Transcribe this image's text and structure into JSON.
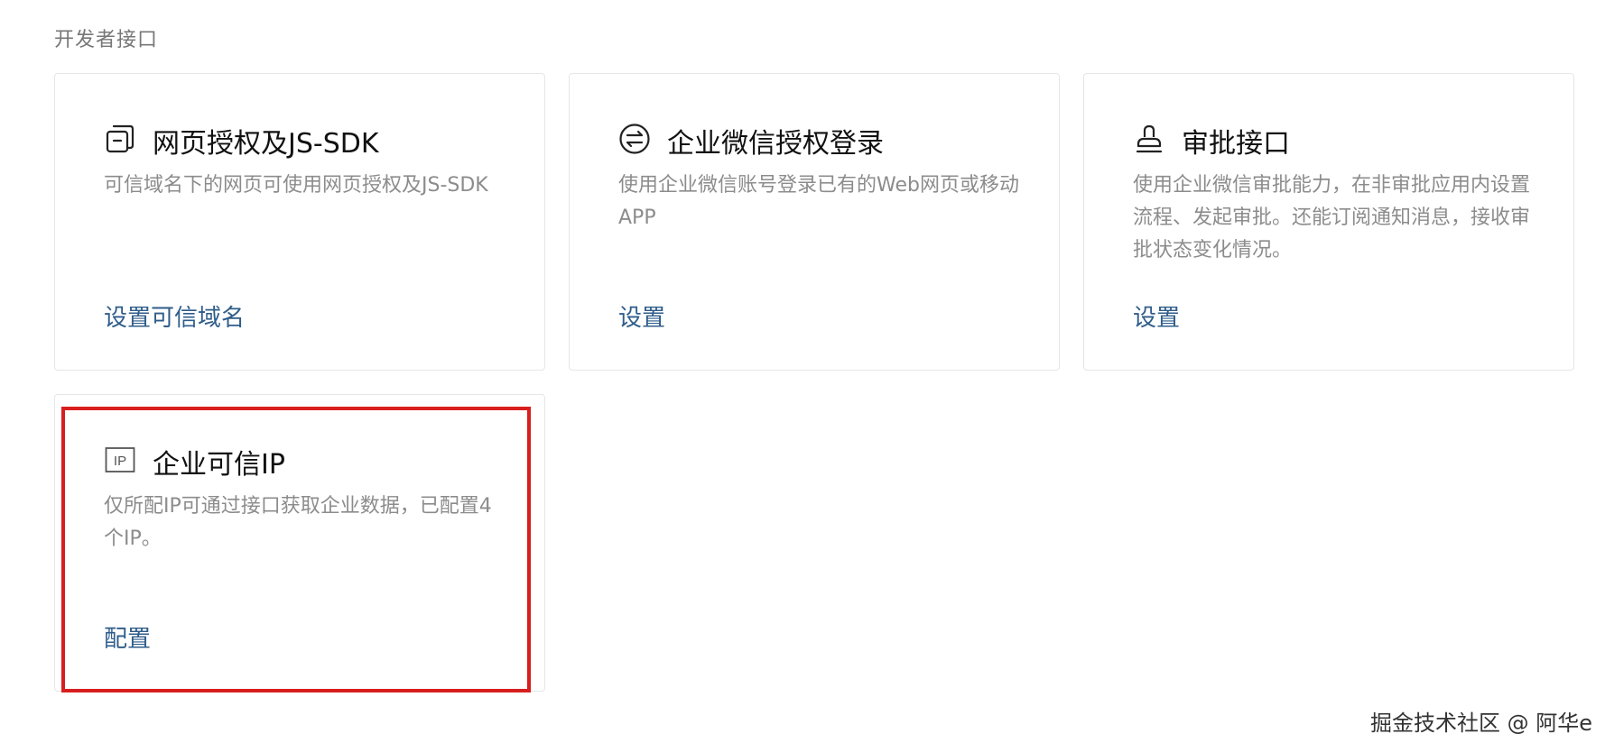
{
  "section": {
    "title": "开发者接口"
  },
  "cards": [
    {
      "icon": "webpage-copy-icon",
      "title": "网页授权及JS-SDK",
      "desc": "可信域名下的网页可使用网页授权及JS-SDK",
      "link": "设置可信域名"
    },
    {
      "icon": "exchange-circle-icon",
      "title": "企业微信授权登录",
      "desc": "使用企业微信账号登录已有的Web网页或移动APP",
      "link": "设置"
    },
    {
      "icon": "stamp-icon",
      "title": "审批接口",
      "desc": "使用企业微信审批能力，在非审批应用内设置流程、发起审批。还能订阅通知消息，接收审批状态变化情况。",
      "link": "设置"
    },
    {
      "icon": "ip-box-icon",
      "icon_text": "IP",
      "title": "企业可信IP",
      "desc": "仅所配IP可通过接口获取企业数据，已配置4个IP。",
      "link": "配置"
    }
  ],
  "watermark": "掘金技术社区 @ 阿华e",
  "colors": {
    "link": "#2f5d8a",
    "highlight": "#d81e1e",
    "border": "#e4e6e9",
    "muted_text": "#8c8c8c"
  }
}
